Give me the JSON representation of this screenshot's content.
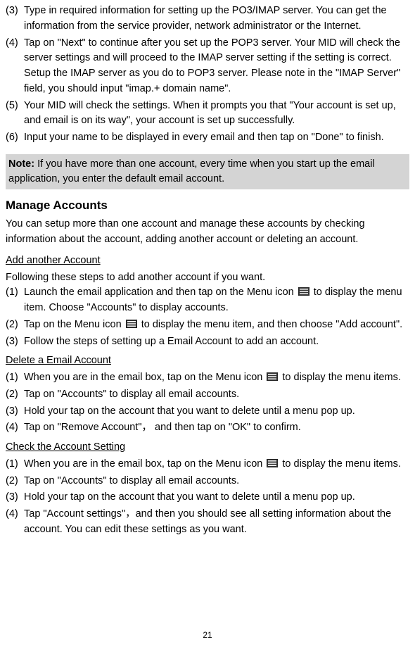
{
  "topSteps": [
    {
      "n": "(3)",
      "t": "Type in required information for setting up the PO3/IMAP server. You can get the information from the service provider, network administrator or the Internet."
    },
    {
      "n": "(4)",
      "t": "Tap on \"Next\" to continue after you set up the POP3 server. Your MID will check the server settings and will proceed to the IMAP server setting if the setting is correct. Setup the IMAP server as you do to POP3 server. Please note in the \"IMAP Server\" field, you should input \"imap.+ domain name\"."
    },
    {
      "n": "(5)",
      "t": "Your MID will check the settings. When it prompts you that \"Your account is set up, and email is on its way\", your account is set up successfully."
    },
    {
      "n": "(6)",
      "t": "Input your name to be displayed in every email and then tap on \"Done\" to finish."
    }
  ],
  "note": {
    "label": "Note:",
    "text": " If you have more than one account, every time when you start up the email application, you enter the default email account."
  },
  "manage": {
    "heading": "Manage Accounts",
    "intro": "You can setup more than one account and manage these accounts by checking information about the account, adding another account or deleting an account."
  },
  "addAnother": {
    "heading": "Add another Account",
    "intro": "Following these steps to add another account if you want.",
    "steps": [
      {
        "n": "(1)",
        "pre": "Launch the email application and then tap on the Menu icon ",
        "post": " to display the menu item. Choose \"Accounts\" to display accounts."
      },
      {
        "n": "(2)",
        "pre": "Tap on the Menu icon ",
        "post": " to display the menu item, and then choose \"Add account\"."
      },
      {
        "n": "(3)",
        "pre": "Follow the steps of setting up a Email Account to add an account.",
        "post": ""
      }
    ]
  },
  "deleteAcc": {
    "heading": "Delete a Email Account",
    "steps": [
      {
        "n": "(1)",
        "pre": "When you are in the email box, tap on the Menu icon ",
        "post": " to display the menu items."
      },
      {
        "n": "(2)",
        "pre": "Tap on \"Accounts\" to display all email accounts.",
        "post": ""
      },
      {
        "n": "(3)",
        "pre": "Hold your tap on the account that you want to delete until a menu pop up.",
        "post": ""
      },
      {
        "n": "(4)",
        "pre": "Tap on \"Remove Account\"， and then tap on \"OK\" to confirm.",
        "post": ""
      }
    ]
  },
  "checkAcc": {
    "heading": "Check the Account Setting",
    "steps": [
      {
        "n": "(1)",
        "pre": "When you are in the email box, tap on the Menu icon ",
        "post": " to display the menu items."
      },
      {
        "n": "(2)",
        "pre": "Tap on \"Accounts\" to display all email accounts.",
        "post": ""
      },
      {
        "n": "(3)",
        "pre": "Hold your tap on the account that you want to delete until a menu pop up.",
        "post": ""
      },
      {
        "n": "(4)",
        "pre": "Tap \"Account settings\"，and then you should see all setting information about the account. You can edit these settings as you want.",
        "post": ""
      }
    ]
  },
  "pageNumber": "21"
}
